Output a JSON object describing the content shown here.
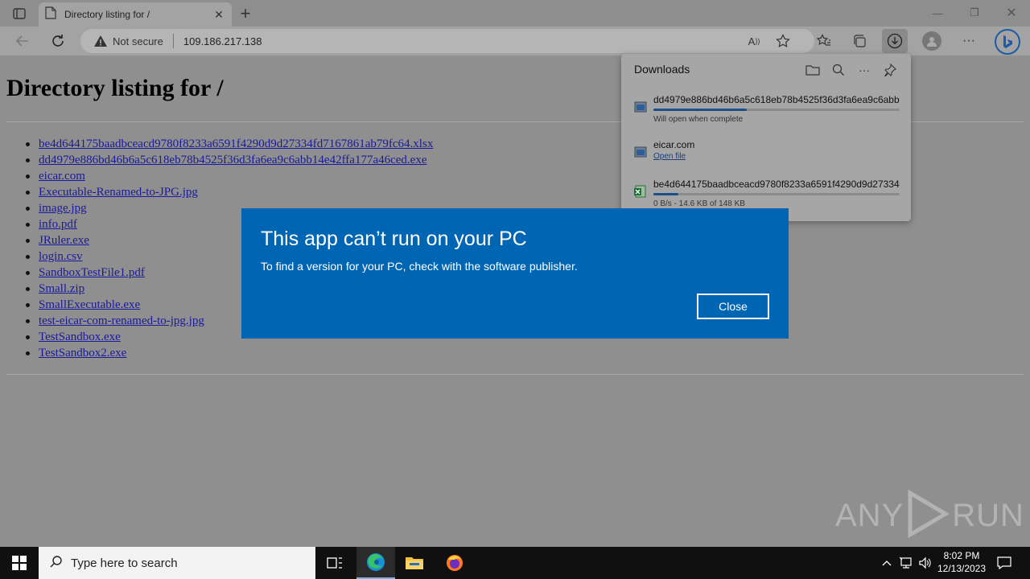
{
  "tab": {
    "title": "Directory listing for /"
  },
  "address_bar": {
    "security_label": "Not secure",
    "url": "109.186.217.138"
  },
  "page": {
    "heading": "Directory listing for /",
    "files": [
      "be4d644175baadbceacd9780f8233a6591f4290d9d27334fd7167861ab79fc64.xlsx",
      "dd4979e886bd46b6a5c618eb78b4525f36d3fa6ea9c6abb14e42ffa177a46ced.exe",
      "eicar.com",
      "Executable-Renamed-to-JPG.jpg",
      "image.jpg",
      "info.pdf",
      "JRuler.exe",
      "login.csv",
      "SandboxTestFile1.pdf",
      "Small.zip",
      "SmallExecutable.exe",
      "test-eicar-com-renamed-to-jpg.jpg",
      "TestSandbox.exe",
      "TestSandbox2.exe"
    ]
  },
  "downloads": {
    "title": "Downloads",
    "items": [
      {
        "name": "dd4979e886bd46b6a5c618eb78b4525f36d3fa6ea9c6abb1...",
        "status": "Will open when complete",
        "progress": 0.38,
        "icon": "exe-file-icon"
      },
      {
        "name": "eicar.com",
        "link": "Open file",
        "icon": "exe-file-icon"
      },
      {
        "name": "be4d644175baadbceacd9780f8233a6591f4290d9d27334f...",
        "status": "0 B/s - 14.6 KB of 148 KB",
        "progress": 0.1,
        "icon": "excel-file-icon"
      }
    ]
  },
  "dialog": {
    "title": "This app can’t run on your PC",
    "message": "To find a version for your PC, check with the software publisher.",
    "close_label": "Close",
    "background": "#0066b4"
  },
  "watermark": {
    "left": "ANY",
    "right": "RUN"
  },
  "taskbar": {
    "search_placeholder": "Type here to search",
    "time": "8:02 PM",
    "date": "12/13/2023"
  }
}
